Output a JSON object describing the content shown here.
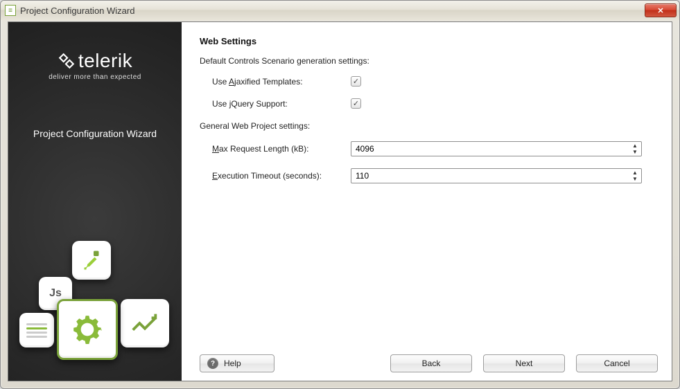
{
  "window": {
    "title": "Project Configuration Wizard"
  },
  "sidebar": {
    "brand_name": "telerik",
    "tagline": "deliver more than expected",
    "subtitle": "Project Configuration Wizard"
  },
  "content": {
    "heading": "Web Settings",
    "section_scenario_label": "Default Controls Scenario generation settings:",
    "ajax_label_pre": "Use ",
    "ajax_label_u": "A",
    "ajax_label_post": "jaxified Templates:",
    "ajax_checked": "✓",
    "jquery_label_pre": "Use ",
    "jquery_label_u": "j",
    "jquery_label_post": "Query Support:",
    "jquery_checked": "✓",
    "section_general_label": "General Web Project settings:",
    "maxreq_label_u": "M",
    "maxreq_label_post": "ax Request Length (kB):",
    "maxreq_value": "4096",
    "exectimeout_label_u": "E",
    "exectimeout_label_post": "xecution Timeout (seconds):",
    "exectimeout_value": "110"
  },
  "footer": {
    "help": "Help",
    "back": "Back",
    "next": "Next",
    "cancel": "Cancel"
  }
}
